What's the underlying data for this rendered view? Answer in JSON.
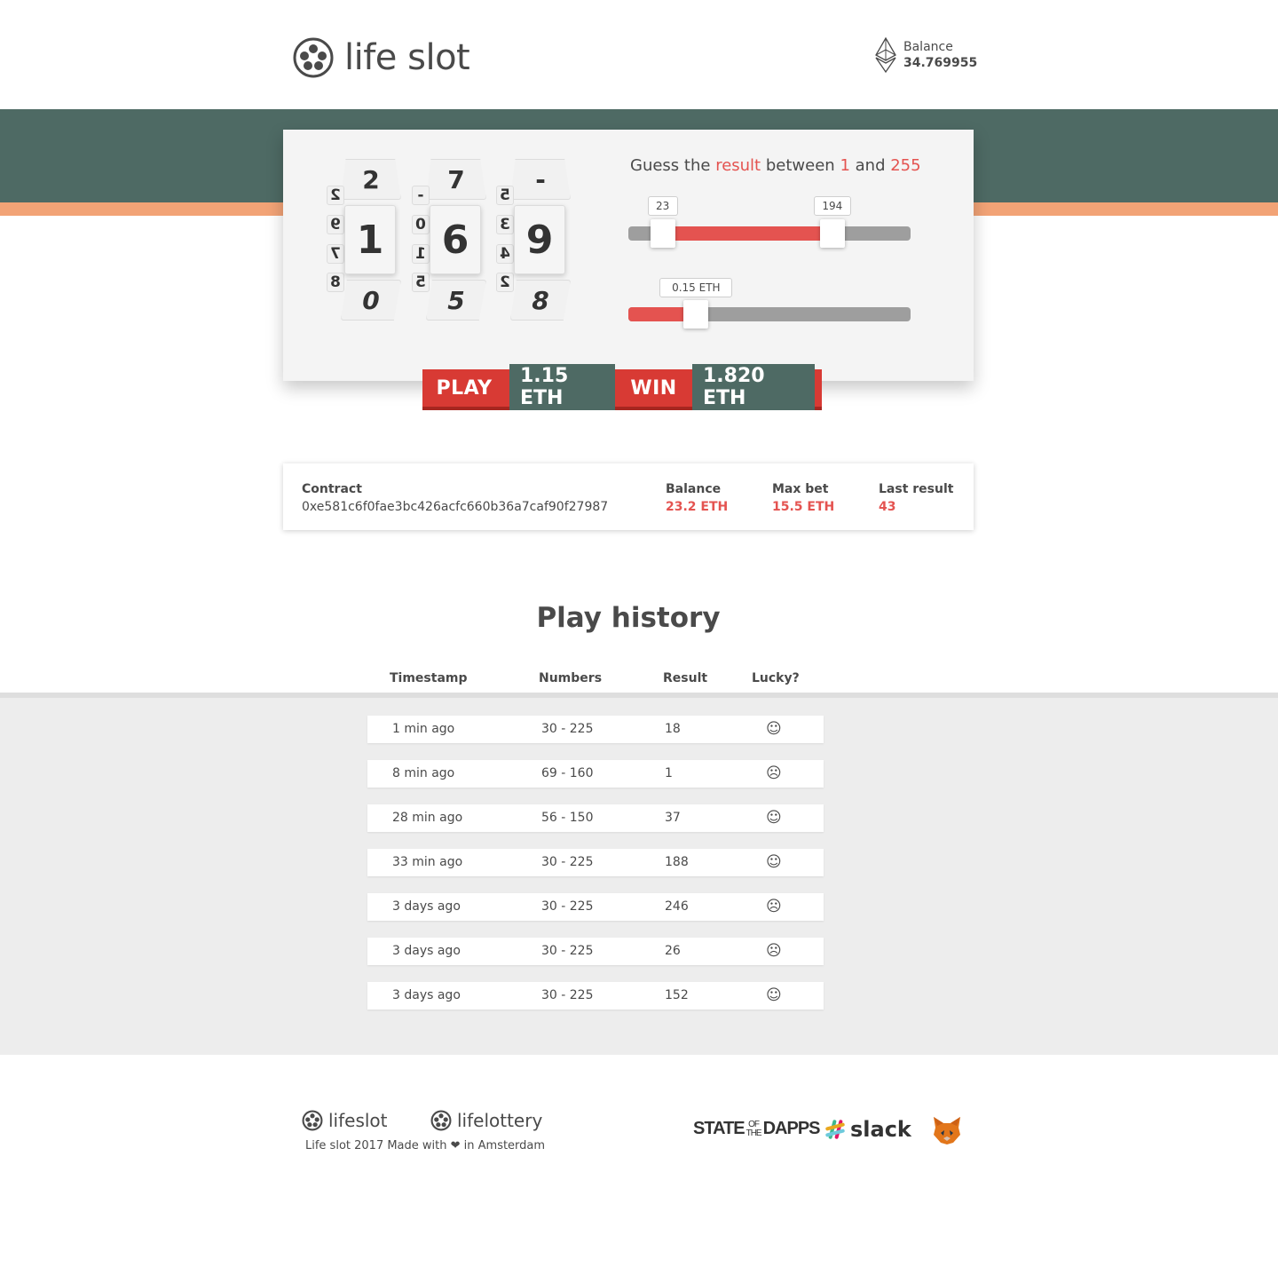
{
  "header": {
    "brand": "life slot",
    "balance_label": "Balance",
    "balance_value": "34.769955"
  },
  "reels": [
    {
      "top": "2",
      "main": "1",
      "bottom": "0",
      "side": [
        "2",
        "9",
        "7",
        "8"
      ]
    },
    {
      "top": "7",
      "main": "6",
      "bottom": "5",
      "side": [
        "-",
        "0",
        "1",
        "5"
      ]
    },
    {
      "top": "-",
      "main": "9",
      "bottom": "8",
      "side": [
        "5",
        "3",
        "4",
        "2"
      ]
    }
  ],
  "guess": {
    "prefix": "Guess the",
    "word_result": "result",
    "between": "between",
    "min": "1",
    "and": "and",
    "max": "255"
  },
  "range_slider": {
    "low": "23",
    "high": "194",
    "low_value": 23,
    "high_value": 194,
    "min": 1,
    "max": 255
  },
  "bet_slider": {
    "label": "0.15 ETH",
    "fraction": 0.24
  },
  "playbar": {
    "play_label": "PLAY",
    "bet_amount": "1.15 ETH",
    "win_label": "WIN",
    "win_amount": "1.820 ETH"
  },
  "contract": {
    "label": "Contract",
    "address": "0xe581c6f0fae3bc426acfc660b36a7caf90f27987",
    "balance_label": "Balance",
    "balance_value": "23.2 ETH",
    "maxbet_label": "Max bet",
    "maxbet_value": "15.5 ETH",
    "last_label": "Last result",
    "last_value": "43"
  },
  "history": {
    "title": "Play history",
    "columns": [
      "Timestamp",
      "Numbers",
      "Result",
      "Lucky?"
    ],
    "rows": [
      {
        "time": "1 min ago",
        "numbers": "30 - 225",
        "result": "18",
        "lucky": "☺"
      },
      {
        "time": "8 min ago",
        "numbers": "69 - 160",
        "result": "1",
        "lucky": "☹"
      },
      {
        "time": "28 min ago",
        "numbers": "56 - 150",
        "result": "37",
        "lucky": "☺"
      },
      {
        "time": "33 min ago",
        "numbers": "30 - 225",
        "result": "188",
        "lucky": "☺"
      },
      {
        "time": "3 days ago",
        "numbers": "30 - 225",
        "result": "246",
        "lucky": "☹"
      },
      {
        "time": "3 days ago",
        "numbers": "30 - 225",
        "result": "26",
        "lucky": "☹"
      },
      {
        "time": "3 days ago",
        "numbers": "30 - 225",
        "result": "152",
        "lucky": "☺"
      }
    ]
  },
  "footer": {
    "brand1": "lifeslot",
    "brand2": "lifelottery",
    "made": "Life slot 2017 Made with ❤ in Amsterdam",
    "partner1_a": "STATE",
    "partner1_b": "OF",
    "partner1_c": "THE",
    "partner1_d": "DAPPS",
    "partner2": "slack",
    "partner3_icon": "metamask-fox-icon"
  },
  "colors": {
    "band": "#4e6a64",
    "accent_orange": "#f2a376",
    "red": "#e45350",
    "play_red": "#d83a34",
    "history_bg": "#ededed"
  }
}
